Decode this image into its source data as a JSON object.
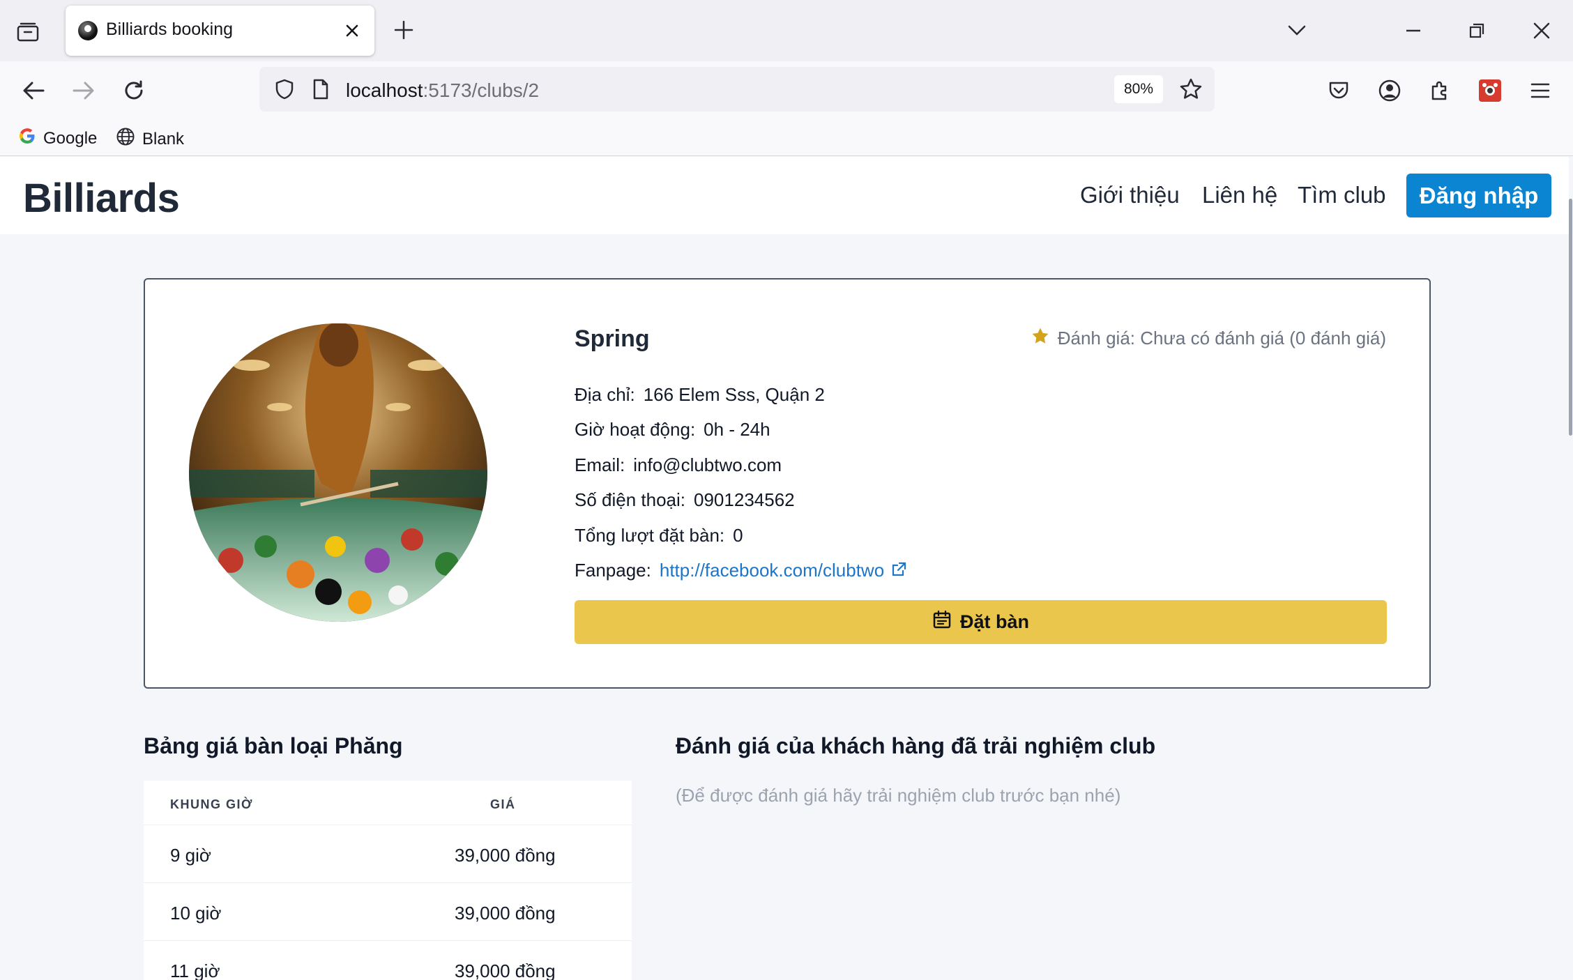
{
  "browser": {
    "tab_title": "Billiards booking",
    "url_host": "localhost",
    "url_path": ":5173/clubs/2",
    "zoom": "80%",
    "bookmarks": [
      {
        "label": "Google",
        "icon": "google-icon"
      },
      {
        "label": "Blank",
        "icon": "globe-icon"
      }
    ]
  },
  "header": {
    "brand": "Billiards",
    "menu": [
      "Giới thiệu",
      "Liên hệ",
      "Tìm club"
    ],
    "login": "Đăng nhập"
  },
  "club": {
    "name": "Spring",
    "rating_text": "Đánh giá: Chưa có đánh giá (0 đánh giá)",
    "address_label": "Địa chỉ:",
    "address": "166 Elem Sss, Quận 2",
    "hours_label": "Giờ hoạt động:",
    "hours": "0h - 24h",
    "email_label": "Email:",
    "email": "info@clubtwo.com",
    "phone_label": "Số điện thoại:",
    "phone": "0901234562",
    "bookings_label": "Tổng lượt đặt bàn:",
    "bookings": "0",
    "fanpage_label": "Fanpage:",
    "fanpage": "http://facebook.com/clubtwo",
    "book_button": "Đặt bàn"
  },
  "price_table": {
    "title": "Bảng giá bàn loại Phăng",
    "columns": [
      "KHUNG GIỜ",
      "GIÁ"
    ],
    "rows": [
      {
        "time": "9 giờ",
        "price": "39,000 đồng"
      },
      {
        "time": "10 giờ",
        "price": "39,000 đồng"
      },
      {
        "time": "11 giờ",
        "price": "39,000 đồng"
      }
    ]
  },
  "reviews": {
    "title": "Đánh giá của khách hàng đã trải nghiệm club",
    "empty_note": "(Để được đánh giá hãy trải nghiệm club trước bạn nhé)"
  },
  "colors": {
    "primary": "#0b84d2",
    "book_button": "#eac74c",
    "star": "#d4a21c",
    "link": "#1d74c8"
  }
}
